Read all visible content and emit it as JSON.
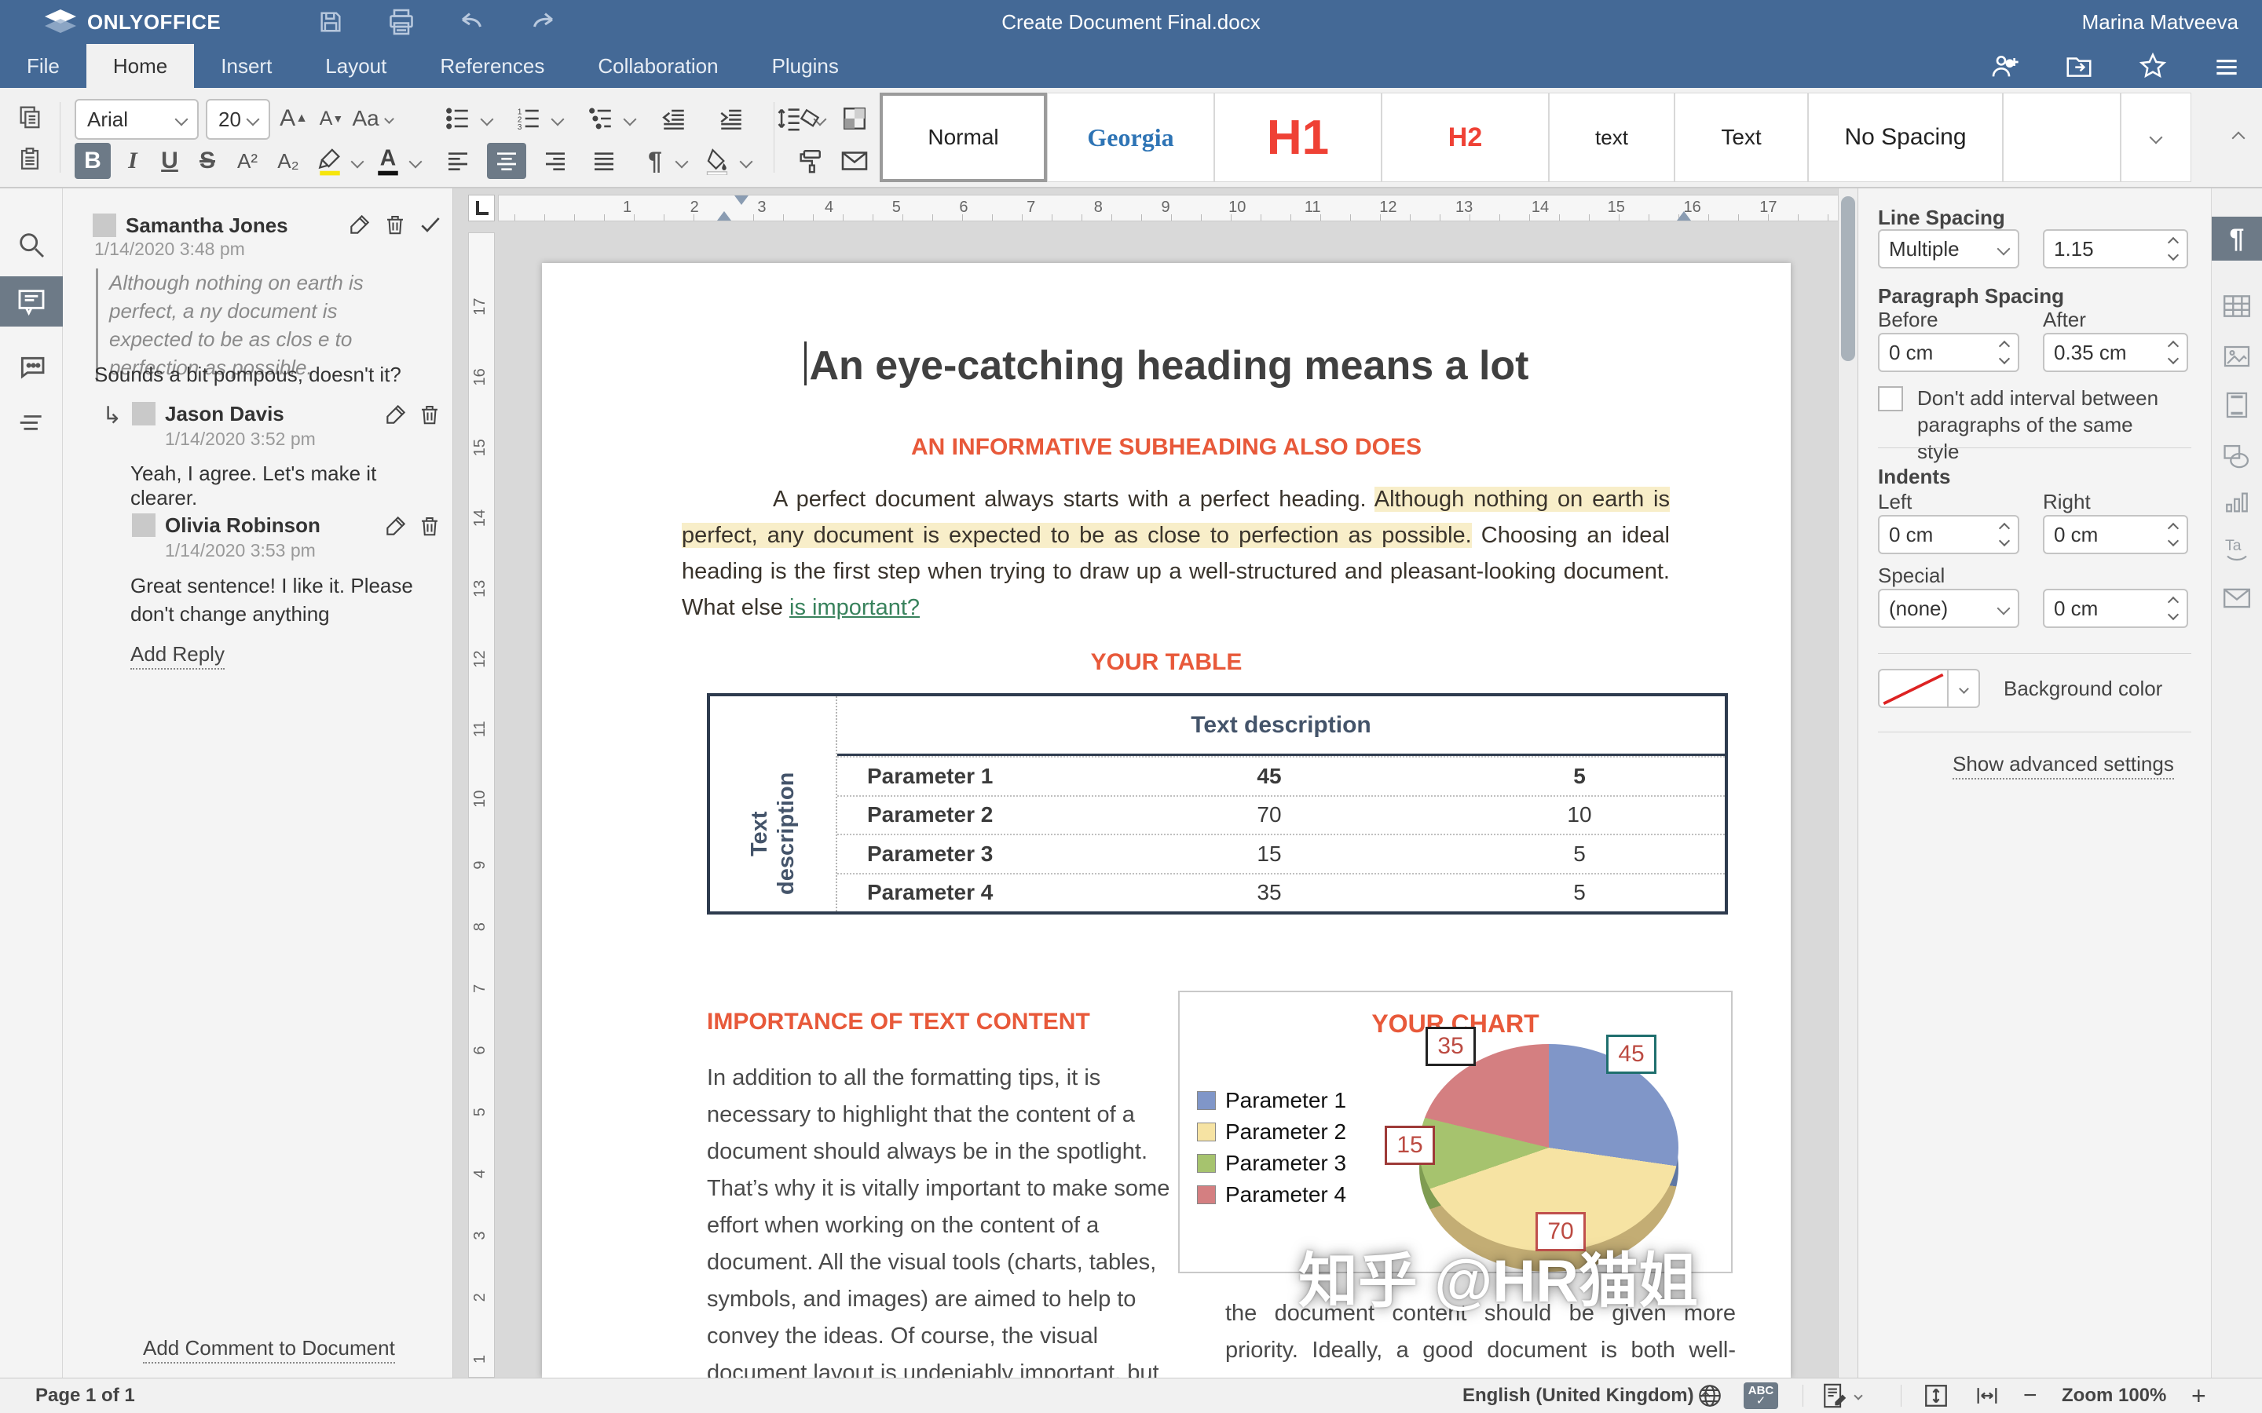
{
  "topbar": {
    "brand": "ONLYOFFICE",
    "title": "Create Document Final.docx",
    "user": "Marina Matveeva"
  },
  "menubar": {
    "tabs": [
      {
        "label": "File"
      },
      {
        "label": "Home",
        "active": true
      },
      {
        "label": "Insert"
      },
      {
        "label": "Layout"
      },
      {
        "label": "References"
      },
      {
        "label": "Collaboration"
      },
      {
        "label": "Plugins"
      }
    ]
  },
  "toolbar": {
    "font_name": "Arial",
    "font_size": "20",
    "bold_label": "B",
    "italic_label": "I",
    "underline_label": "U",
    "strike_label": "S",
    "superscript_label": "A²",
    "subscript_label": "A₂",
    "font_color_label": "A",
    "inc_font_label": "A",
    "dec_font_label": "A",
    "case_label": "Aa",
    "paragraph_mark_label": "¶",
    "styles": [
      "Normal",
      "Georgia",
      "H1",
      "H2",
      "text",
      "Text",
      "No Spacing"
    ]
  },
  "comments": {
    "items": [
      {
        "author": "Samantha Jones",
        "date": "1/14/2020 3:48 pm",
        "quote": "Although nothing on earth is perfect, a ny document is expected to be as clos e to perfection as possible.",
        "text": "Sounds a bit pompous, doesn't it?"
      },
      {
        "author": "Jason Davis",
        "date": "1/14/2020 3:52 pm",
        "text": "Yeah, I agree. Let's make it clearer."
      },
      {
        "author": "Olivia Robinson",
        "date": "1/14/2020 3:53 pm",
        "text": "Great sentence! I like it. Please don't change anything"
      }
    ],
    "add_reply": "Add Reply",
    "add_comment": "Add Comment to Document"
  },
  "ruler": {
    "h_numbers": "1 2 3 4 5 6 7 8 9 10 11 12 13 14 15 16 17",
    "v_numbers": "1 2 3 4 5 6 7 8 9 10 11 12 13 14 15 16 17"
  },
  "document": {
    "heading": "An eye-catching heading means a lot",
    "subheading": "AN INFORMATIVE SUBHEADING ALSO DOES",
    "para1_before": "A perfect document always starts with a perfect heading. ",
    "para1_highlight": "Although nothing on earth is perfect, any document is expected to be as close to perfection as possible.",
    "para1_mid": " Choosing an ideal heading is the first step when trying to draw up a well-structured and pleasant-looking document. What else  ",
    "para1_link": "is important?",
    "table_title": "YOUR TABLE",
    "table": {
      "header": "Text description",
      "row_header": "Text description",
      "rows": [
        [
          "Parameter 1",
          "45",
          "5"
        ],
        [
          "Parameter 2",
          "70",
          "10"
        ],
        [
          "Parameter 3",
          "15",
          "5"
        ],
        [
          "Parameter 4",
          "35",
          "5"
        ]
      ]
    },
    "section2_title": "IMPORTANCE OF TEXT CONTENT",
    "section2_text": "In addition to all the formatting tips, it is necessary to highlight that the content of a document should always be in the spotlight. That’s why it is vitally important to make some effort when working on the content of a document. All the visual tools (charts, tables, symbols, and images) are aimed to help to convey the ideas. Of course, the visual document layout is undeniably important, but",
    "section2_text_right": "the document content should be given more priority. Ideally, a good document is both well-designed and easy to read and understand"
  },
  "chart_data": {
    "type": "pie",
    "title": "YOUR CHART",
    "categories": [
      "Parameter 1",
      "Parameter 2",
      "Parameter 3",
      "Parameter 4"
    ],
    "values": [
      45,
      70,
      15,
      35
    ],
    "colors": [
      "#8096c8",
      "#f6e3a3",
      "#a6c36e",
      "#d47f81"
    ],
    "data_labels": [
      "45",
      "70",
      "15",
      "35"
    ],
    "legend_position": "left",
    "style": "3d-pie"
  },
  "right_panel": {
    "line_spacing_label": "Line Spacing",
    "line_spacing_value": "Multiple",
    "line_spacing_amount": "1.15",
    "paragraph_spacing_label": "Paragraph Spacing",
    "before_label": "Before",
    "after_label": "After",
    "before_value": "0 cm",
    "after_value": "0.35 cm",
    "interval_checkbox_label": "Don't add interval between paragraphs of the same style",
    "indents_label": "Indents",
    "left_label": "Left",
    "right_label": "Right",
    "left_value": "0 cm",
    "right_value": "0 cm",
    "special_label": "Special",
    "special_value": "(none)",
    "special_amount": "0 cm",
    "background_label": "Background color",
    "advanced_link": "Show advanced settings"
  },
  "statusbar": {
    "page": "Page 1 of 1",
    "language": "English (United Kingdom)",
    "spellcheck": "ABC",
    "zoom": "Zoom 100%",
    "zoom_out": "−",
    "zoom_in": "+"
  },
  "watermark": "知乎 @HR猫姐",
  "colors": {
    "topbar": "#446996",
    "accent_orange": "#e8593a",
    "style_red": "#ef4135",
    "style_blue": "#2e74b5",
    "table_navy": "#2e3b4e",
    "highlight": "#f8eec9",
    "link_green": "#38825c",
    "active_gray": "#6d7a87"
  }
}
